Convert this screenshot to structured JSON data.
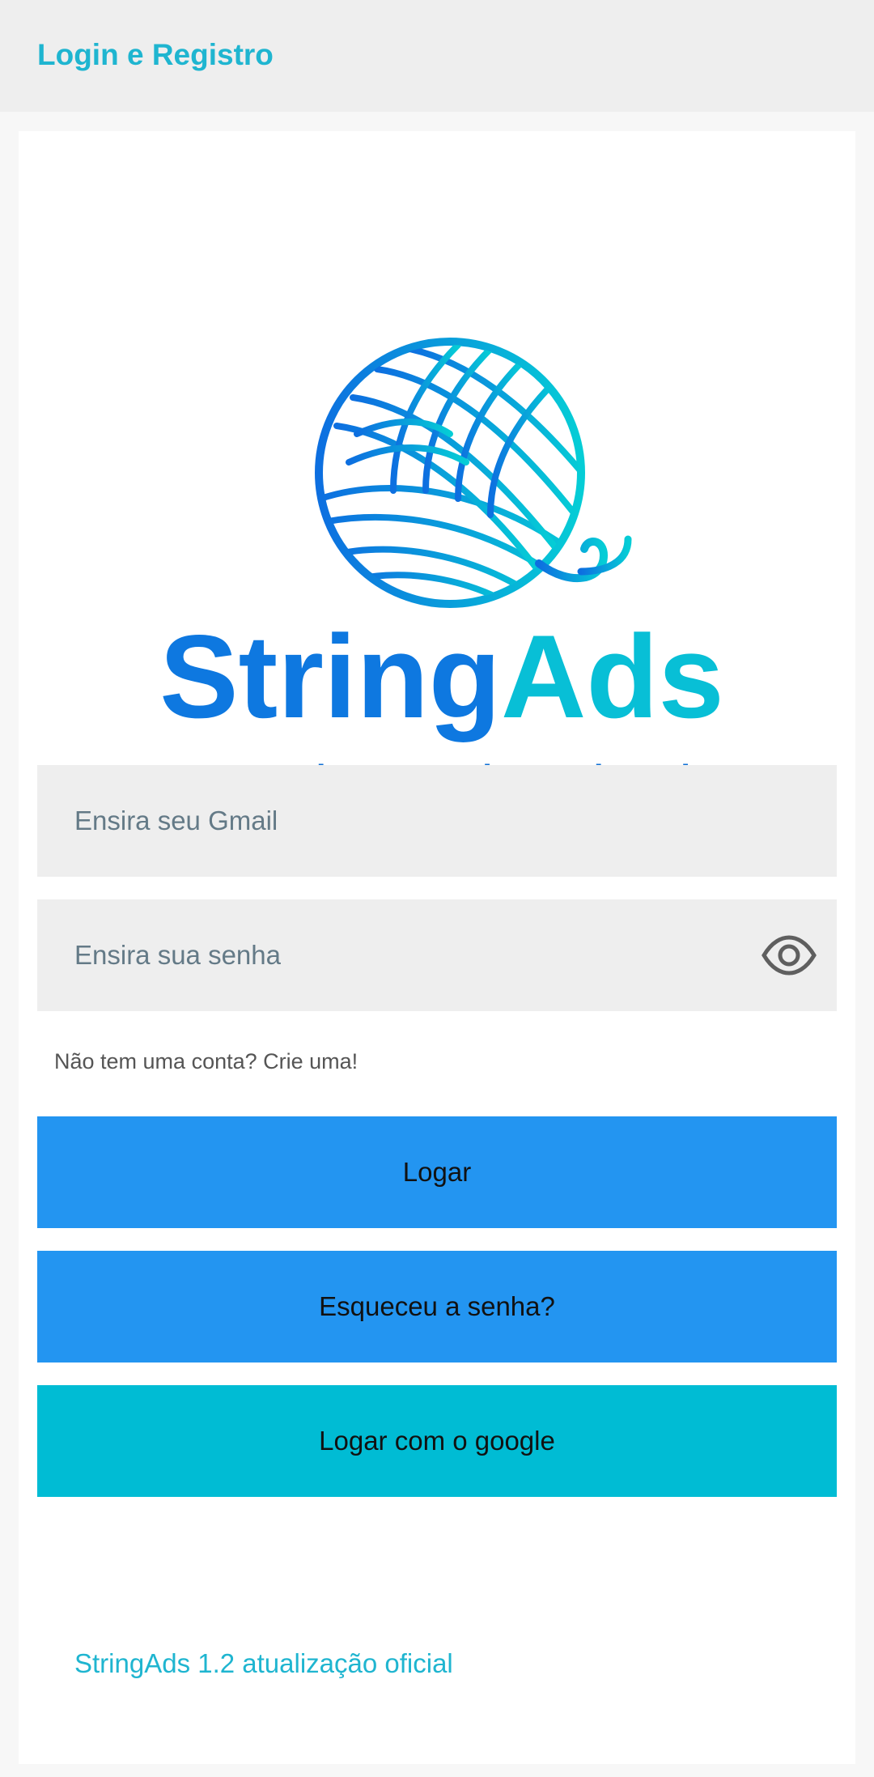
{
  "app_bar": {
    "title": "Login e Registro"
  },
  "logo": {
    "brand_part1": "String",
    "brand_part2": "Ads",
    "tagline": "Desenvolva, Monetize, StringAds",
    "icon": "yarn-ball-icon"
  },
  "form": {
    "email_placeholder": "Ensira seu Gmail",
    "email_value": "",
    "password_placeholder": "Ensira sua senha",
    "password_value": "",
    "password_toggle_icon": "eye-icon",
    "signup_link": "Não tem uma conta? Crie uma!"
  },
  "buttons": {
    "login": "Logar",
    "forgot": "Esqueceu a senha?",
    "google": "Logar com o google"
  },
  "footer": {
    "version_text": "StringAds 1.2 atualização oficial"
  },
  "colors": {
    "accent": "#1fb5d0",
    "primary_button": "#2395f1",
    "google_button": "#00bcd4",
    "logo_gradient_start": "#0d6fe0",
    "logo_gradient_end": "#05cdd6"
  }
}
